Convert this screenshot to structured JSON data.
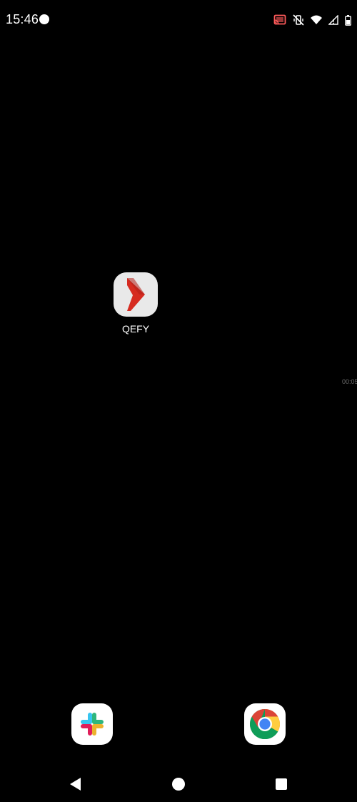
{
  "status_bar": {
    "time": "15:46",
    "icons": [
      "notification-dot",
      "cast-icon",
      "vibrate-off-icon",
      "wifi-icon",
      "signal-icon",
      "battery-icon"
    ]
  },
  "home": {
    "apps": [
      {
        "label": "QEFY",
        "icon": "qefy-logo"
      }
    ],
    "edge_timer_text": "00:05"
  },
  "dock": {
    "apps": [
      {
        "name": "Slack",
        "icon": "slack-logo"
      },
      {
        "name": "Chrome",
        "icon": "chrome-logo"
      }
    ]
  },
  "navigation": {
    "buttons": [
      "back",
      "home",
      "recents"
    ]
  },
  "colors": {
    "background": "#000000",
    "qefy_red": "#d62b20",
    "qefy_bg": "#e9e9e9"
  }
}
